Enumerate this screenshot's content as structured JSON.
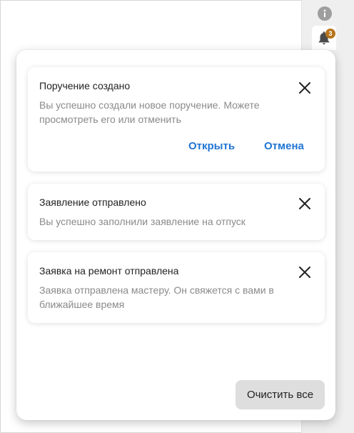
{
  "topbar": {
    "info_icon": "info-icon",
    "bell_icon": "bell-icon",
    "notification_count": "3",
    "badge_color": "#b8741a"
  },
  "notifications": [
    {
      "title": "Поручение создано",
      "text": "Вы успешно создали новое поручение. Можете просмотреть его или отменить",
      "actions": [
        "Открыть",
        "Отмена"
      ]
    },
    {
      "title": "Заявление отправлено",
      "text": "Вы успешно заполнили заявление на отпуск"
    },
    {
      "title": "Заявка на ремонт отправлена",
      "text": "Заявка отправлена мастеру. Он свяжется с вами в ближайшее время"
    }
  ],
  "footer": {
    "clear_all_label": "Очистить все"
  },
  "colors": {
    "accent": "#1f74d4",
    "muted_text": "#8a8a8a"
  }
}
